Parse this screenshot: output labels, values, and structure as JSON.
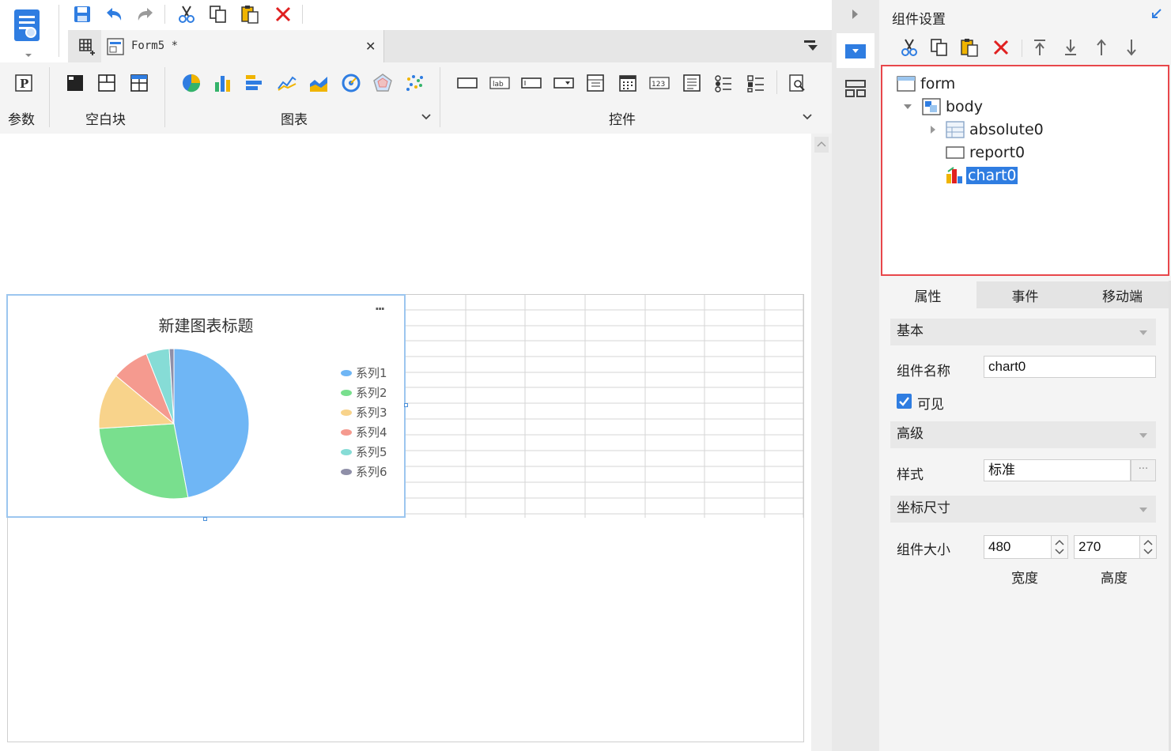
{
  "toolbar": {
    "icons": [
      "save-icon",
      "undo-icon",
      "redo-icon",
      "cut-icon",
      "copy-icon",
      "paste-icon",
      "delete-icon"
    ]
  },
  "tab": {
    "label": "Form5 *",
    "close": "✕"
  },
  "ribbon": {
    "groups": {
      "param": "参数",
      "blank_block": "空白块",
      "chart": "图表",
      "control": "控件"
    },
    "param_icon_text": "P",
    "label_icon_text": "lab",
    "number_icon_text": "123"
  },
  "canvas": {
    "chart_widget": {
      "more": "···"
    }
  },
  "chart_data": {
    "type": "pie",
    "title": "新建图表标题",
    "series": [
      {
        "name": "系列1",
        "value": 47,
        "color": "#6fb6f5"
      },
      {
        "name": "系列2",
        "value": 27,
        "color": "#79df8e"
      },
      {
        "name": "系列3",
        "value": 12,
        "color": "#f8d38b"
      },
      {
        "name": "系列4",
        "value": 8,
        "color": "#f59a8f"
      },
      {
        "name": "系列5",
        "value": 5,
        "color": "#86dcd6"
      },
      {
        "name": "系列6",
        "value": 1,
        "color": "#8f8fa8"
      }
    ],
    "legend_position": "right"
  },
  "right_panel": {
    "title": "组件设置",
    "tree": {
      "form": "form",
      "body": "body",
      "absolute": "absolute0",
      "report": "report0",
      "chart": "chart0"
    },
    "tabs": [
      "属性",
      "事件",
      "移动端"
    ],
    "sections": {
      "basic": "基本",
      "advanced": "高级",
      "coord_size": "坐标尺寸"
    },
    "fields": {
      "name_label": "组件名称",
      "name_value": "chart0",
      "visible_label": "可见",
      "style_label": "样式",
      "style_value": "标准",
      "style_more": "···",
      "size_label": "组件大小",
      "width_value": "480",
      "height_value": "270",
      "width_caption": "宽度",
      "height_caption": "高度"
    }
  }
}
